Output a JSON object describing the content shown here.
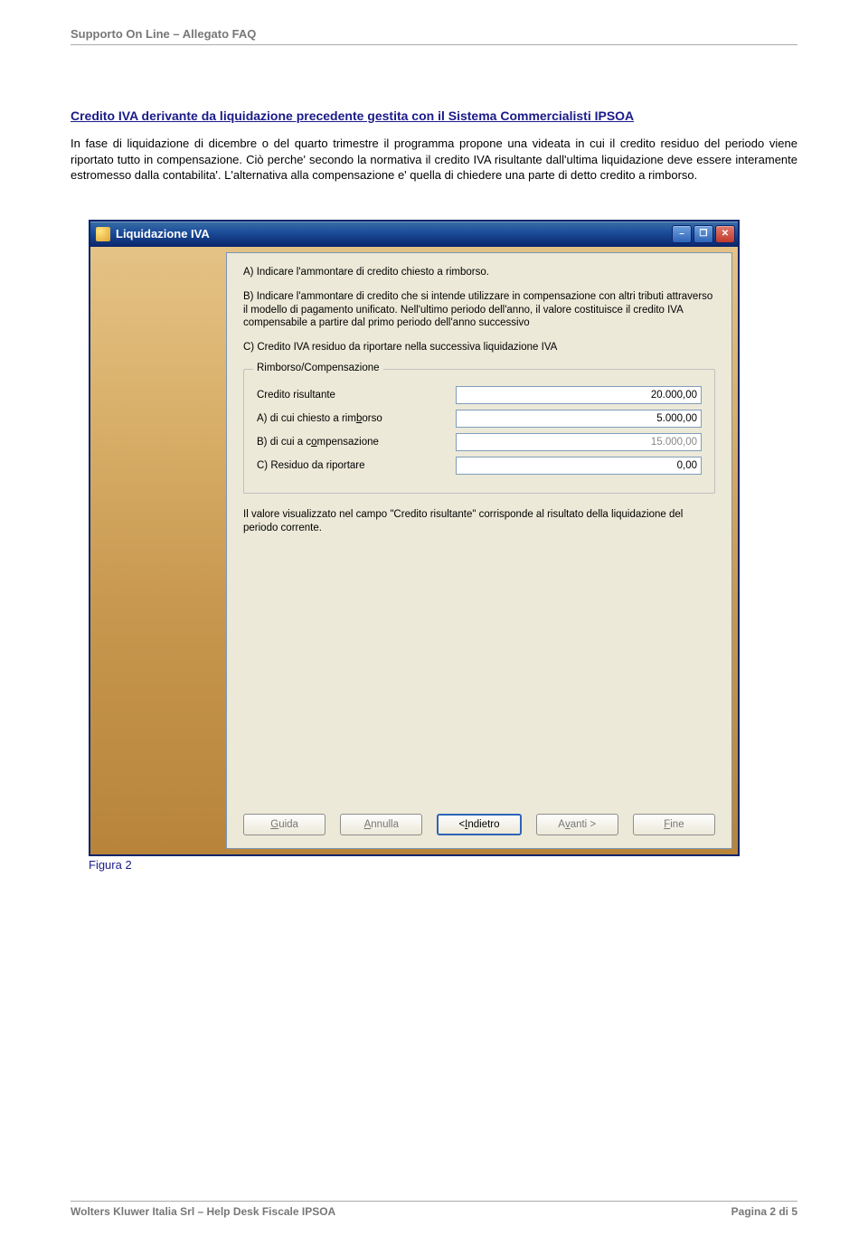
{
  "doc": {
    "header": "Supporto On Line – Allegato FAQ",
    "section_title": "Credito IVA derivante da liquidazione precedente gestita con il Sistema Commercialisti IPSOA",
    "body_text": "In fase di liquidazione di dicembre o del quarto trimestre il programma propone una videata in cui il credito residuo del periodo viene riportato tutto in compensazione. Ciò perche' secondo la normativa il credito IVA risultante dall'ultima liquidazione deve essere interamente estromesso dalla contabilita'. L'alternativa alla compensazione e' quella di chiedere una parte di detto credito a rimborso.",
    "figure_caption": "Figura 2",
    "footer_left": "Wolters Kluwer Italia Srl – Help Desk Fiscale IPSOA",
    "footer_right": "Pagina 2 di 5"
  },
  "window": {
    "title": "Liquidazione IVA",
    "instructions": {
      "a": "A) Indicare l'ammontare di credito chiesto a rimborso.",
      "b": "B) Indicare l'ammontare di credito che si intende utilizzare in compensazione con altri tributi attraverso il modello di pagamento unificato. Nell'ultimo periodo dell'anno, il valore costituisce il credito IVA compensabile a partire dal primo periodo dell'anno successivo",
      "c": "C) Credito IVA residuo da riportare nella successiva liquidazione IVA"
    },
    "fieldset_legend": "Rimborso/Compensazione",
    "fields": {
      "credito": {
        "label": "Credito risultante",
        "value": "20.000,00"
      },
      "rimborso": {
        "label_pre": "A) di cui chiesto a rim",
        "accel": "b",
        "label_post": "orso",
        "value": "5.000,00"
      },
      "compensazione": {
        "label_pre": "B) di cui a c",
        "accel": "o",
        "label_post": "mpensazione",
        "value": "15.000,00"
      },
      "residuo": {
        "label": "C) Residuo da riportare",
        "value": "0,00"
      }
    },
    "note": "Il valore visualizzato nel campo \"Credito risultante\" corrisponde al risultato della liquidazione del periodo corrente.",
    "buttons": {
      "guida": {
        "accel": "G",
        "rest": "uida"
      },
      "annulla": {
        "accel": "A",
        "rest": "nnulla"
      },
      "indietro": {
        "pre": "< ",
        "accel": "I",
        "rest": "ndietro"
      },
      "avanti": {
        "pre": "A",
        "accel": "v",
        "rest": "anti >"
      },
      "fine": {
        "accel": "F",
        "rest": "ine"
      }
    }
  }
}
